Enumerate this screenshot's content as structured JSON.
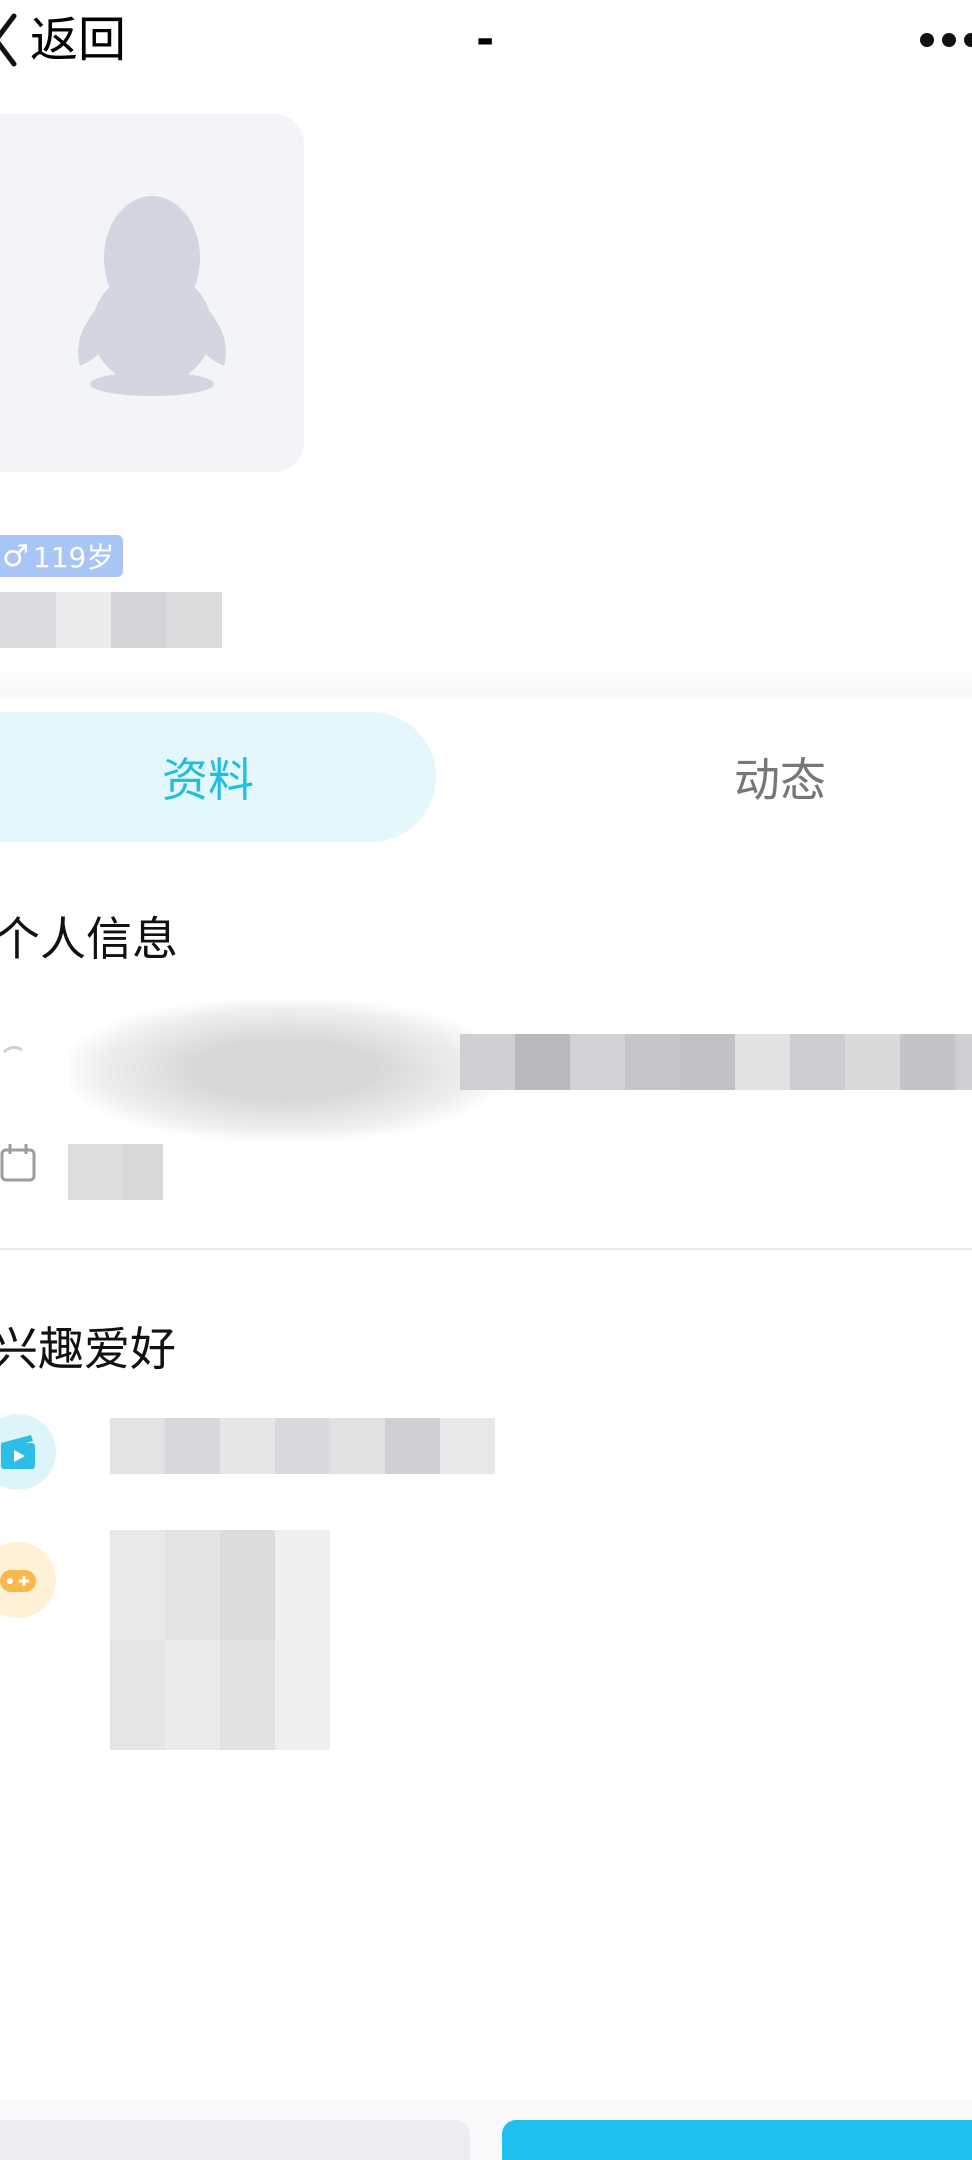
{
  "navbar": {
    "back_label": "返回",
    "title": "-",
    "more_icon": "more-dots-icon"
  },
  "profile": {
    "avatar_icon": "penguin-default-avatar-icon",
    "gender_symbol": "♂",
    "age": "119岁",
    "badge_color": "#a9c5f5"
  },
  "tabs": [
    {
      "label": "资料",
      "active": true
    },
    {
      "label": "动态",
      "active": false
    }
  ],
  "personal_info": {
    "title": "个人信息"
  },
  "interests": {
    "title": "兴趣爱好",
    "items": [
      {
        "icon": "film-icon",
        "color": "#2bbfe8"
      },
      {
        "icon": "game-controller-icon",
        "color": "#f8b84a"
      }
    ]
  },
  "colors": {
    "accent": "#20bfe0",
    "primary_button": "#1fbff0"
  }
}
